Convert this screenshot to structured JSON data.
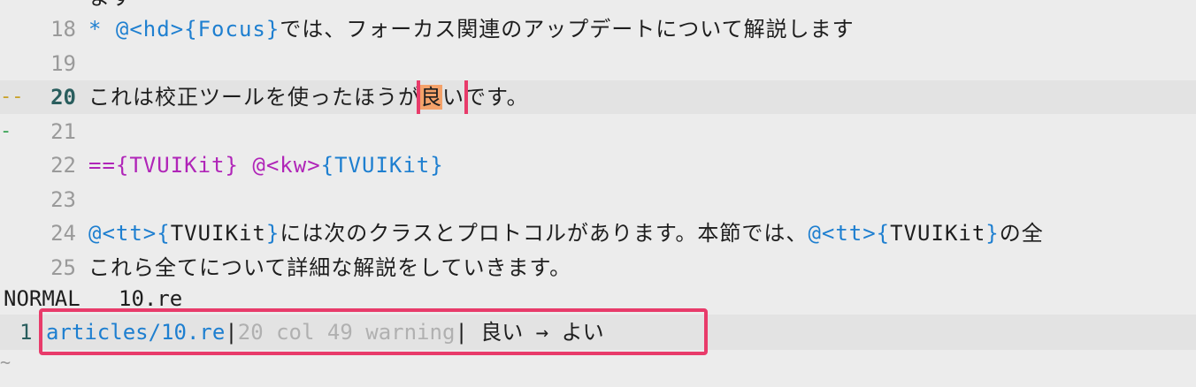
{
  "buffer": {
    "top_fragment": "ます",
    "lines": [
      {
        "num": "18",
        "sign": "",
        "parts": [
          {
            "t": " * @<hd>{Focus}",
            "c": "blue"
          },
          {
            "t": "では、フォーカス関連のアップデートについて解説します",
            "c": ""
          }
        ]
      },
      {
        "num": "19",
        "sign": "",
        "parts": []
      },
      {
        "num": "20",
        "sign": "--",
        "current": true,
        "parts": [
          {
            "t": " これは校正ツールを使ったほうが",
            "c": ""
          },
          {
            "t": "良い",
            "c": "target"
          },
          {
            "t": "です。",
            "c": ""
          }
        ]
      },
      {
        "num": "21",
        "sign": "-",
        "parts": []
      },
      {
        "num": "22",
        "sign": "",
        "parts": [
          {
            "t": "=={TVUIKit} ",
            "c": "mag"
          },
          {
            "t": "@<kw>",
            "c": "mag"
          },
          {
            "t": "{TVUIKit}",
            "c": "blue"
          }
        ]
      },
      {
        "num": "23",
        "sign": "",
        "parts": []
      },
      {
        "num": "24",
        "sign": "",
        "parts": [
          {
            "t": "@<tt>{",
            "c": "blue"
          },
          {
            "t": "TVUIKit",
            "c": ""
          },
          {
            "t": "}",
            "c": "blue"
          },
          {
            "t": "には次のクラスとプロトコルがあります。本節では、",
            "c": ""
          },
          {
            "t": "@<tt>{",
            "c": "blue"
          },
          {
            "t": "TVUIKit",
            "c": ""
          },
          {
            "t": "}",
            "c": "blue"
          },
          {
            "t": "の全",
            "c": ""
          }
        ]
      },
      {
        "num": "25",
        "sign": "",
        "parts": [
          {
            "t": "これら全てについて詳細な解説をしていきます。",
            "c": ""
          }
        ]
      }
    ]
  },
  "statusline": {
    "mode": "NORMAL",
    "filename": "10.re"
  },
  "quickfix": {
    "index": "1",
    "path": "articles/10.re",
    "sep1": "|",
    "location": "20 col 49 warning",
    "sep2": "|",
    "message": " 良い → よい"
  },
  "end_marker": "~"
}
